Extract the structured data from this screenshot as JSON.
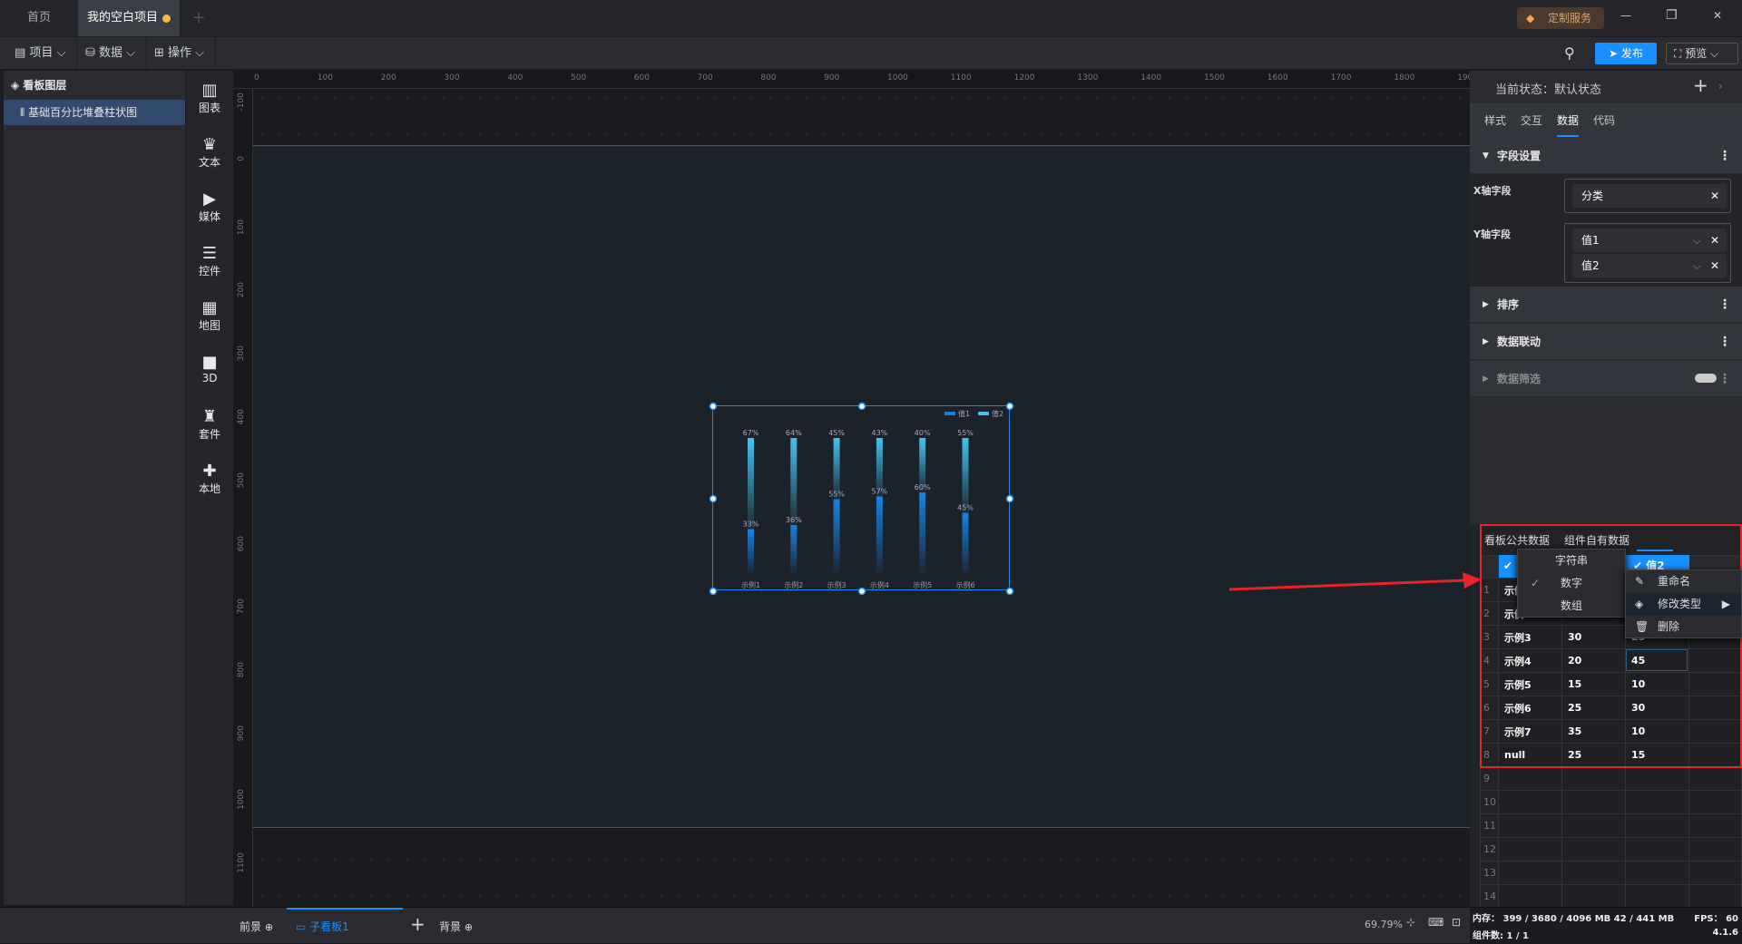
{
  "tabs": {
    "home": "首页",
    "project": "我的空白项目",
    "add": "+"
  },
  "topright": {
    "custom_service": "定制服务",
    "minimize": "—",
    "restore": "❐",
    "close": "✕"
  },
  "toolbar": {
    "project": "项目",
    "data": "数据",
    "operate": "操作",
    "publish": "发布",
    "preview": "预览"
  },
  "layers": {
    "title": "看板图层",
    "items": [
      {
        "label": "基础百分比堆叠柱状图"
      }
    ]
  },
  "components": [
    {
      "label": "图表",
      "icon": "chart-icon",
      "g": "▥"
    },
    {
      "label": "文本",
      "icon": "text-icon",
      "g": "♛"
    },
    {
      "label": "媒体",
      "icon": "media-icon",
      "g": "▶"
    },
    {
      "label": "控件",
      "icon": "control-icon",
      "g": "☰"
    },
    {
      "label": "地图",
      "icon": "map-icon",
      "g": "▦"
    },
    {
      "label": "3D",
      "icon": "cube-icon",
      "g": "■"
    },
    {
      "label": "套件",
      "icon": "kit-icon",
      "g": "♜"
    },
    {
      "label": "本地",
      "icon": "puzzle-icon",
      "g": "✚"
    }
  ],
  "ruler": {
    "top": [
      "0",
      "100",
      "200",
      "300",
      "400",
      "500",
      "600",
      "700",
      "800",
      "900",
      "1000",
      "1100",
      "1200",
      "1300",
      "1400",
      "1500",
      "1600",
      "1700",
      "1800",
      "1900"
    ],
    "left": [
      "-100",
      "0",
      "100",
      "200",
      "300",
      "400",
      "500",
      "600",
      "700",
      "800",
      "900",
      "1000",
      "1100"
    ]
  },
  "chart_data": {
    "type": "bar",
    "stacked": "percent",
    "categories": [
      "示例1",
      "示例2",
      "示例3",
      "示例4",
      "示例5",
      "示例6"
    ],
    "series": [
      {
        "name": "值1",
        "values": [
          33,
          36,
          55,
          57,
          60,
          45
        ],
        "labels": [
          "33%",
          "36%",
          "55%",
          "57%",
          "60%",
          "45%"
        ],
        "color": "#1583e6"
      },
      {
        "name": "值2",
        "values": [
          67,
          64,
          45,
          43,
          40,
          55
        ],
        "labels": [
          "67%",
          "64%",
          "45%",
          "43%",
          "40%",
          "55%"
        ],
        "color": "#45c4ee"
      }
    ],
    "legend": "top-right",
    "ylim": [
      0,
      100
    ]
  },
  "panel": {
    "state_label": "当前状态：默认状态",
    "tabs": [
      "样式",
      "交互",
      "数据",
      "代码"
    ],
    "active_tab": "数据",
    "field_settings": "字段设置",
    "x_field_label": "X轴字段",
    "x_field": "分类",
    "y_field_label": "Y轴字段",
    "y_fields": [
      "值1",
      "值2"
    ],
    "sort": "排序",
    "linkage": "数据联动",
    "filter": "数据筛选"
  },
  "datatabs": {
    "public": "看板公共数据",
    "own": "组件自有数据"
  },
  "table": {
    "header_col3": "值2",
    "rows": [
      [
        "1",
        "示例1",
        "",
        ""
      ],
      [
        "2",
        "示例2",
        "",
        ""
      ],
      [
        "3",
        "示例3",
        "30",
        "25"
      ],
      [
        "4",
        "示例4",
        "20",
        "45"
      ],
      [
        "5",
        "示例5",
        "15",
        "10"
      ],
      [
        "6",
        "示例6",
        "25",
        "30"
      ],
      [
        "7",
        "示例7",
        "35",
        "10"
      ],
      [
        "8",
        "null",
        "25",
        "15"
      ],
      [
        "9",
        "",
        "",
        ""
      ],
      [
        "10",
        "",
        "",
        ""
      ],
      [
        "11",
        "",
        "",
        ""
      ],
      [
        "12",
        "",
        "",
        ""
      ],
      [
        "13",
        "",
        "",
        ""
      ],
      [
        "14",
        "",
        "",
        ""
      ]
    ]
  },
  "type_menu": {
    "items": [
      "字符串",
      "数字",
      "数组"
    ],
    "checked": "数字"
  },
  "context_menu": {
    "items": [
      "重命名",
      "修改类型",
      "删除"
    ]
  },
  "bottombar": {
    "foreground": "前景",
    "subboard": "子看板1",
    "background": "背景",
    "zoom": "69.79%",
    "memory": "内存： 399 / 3680 / 4096 MB  42 / 441 MB",
    "fps": "FPS： 60",
    "count": "组件数: 1 / 1",
    "version": "4.1.6"
  },
  "colors": {
    "accent": "#1890ff",
    "highlight": "#e5242b"
  }
}
